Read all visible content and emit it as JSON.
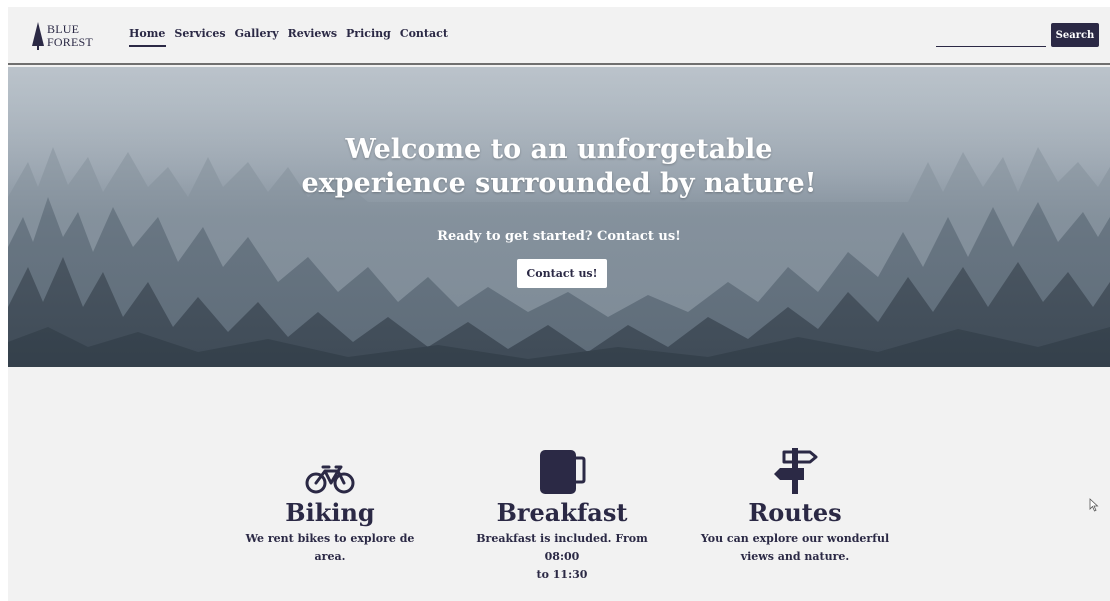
{
  "brand": {
    "line1": "BLUE",
    "line2": "FOREST",
    "logo_icon": "tree-icon"
  },
  "nav": {
    "items": [
      {
        "label": "Home",
        "active": true
      },
      {
        "label": "Services"
      },
      {
        "label": "Gallery"
      },
      {
        "label": "Reviews"
      },
      {
        "label": "Pricing"
      },
      {
        "label": "Contact"
      }
    ]
  },
  "search": {
    "placeholder": "",
    "value": "",
    "button_label": "Search"
  },
  "hero": {
    "title_line1": "Welcome to an unforgetable",
    "title_line2": "experience surrounded by nature!",
    "subtitle": "Ready to get started? Contact us!",
    "button_label": "Contact us!"
  },
  "features": [
    {
      "icon": "bicycle-icon",
      "title": "Biking",
      "text_line1": "We rent bikes to explore de area.",
      "text_line2": ""
    },
    {
      "icon": "mug-icon",
      "title": "Breakfast",
      "text_line1": "Breakfast is included. From 08:00",
      "text_line2": "to 11:30"
    },
    {
      "icon": "signpost-icon",
      "title": "Routes",
      "text_line1": "You can explore our wonderful",
      "text_line2": "views and nature."
    }
  ],
  "colors": {
    "primary": "#2b2945",
    "background": "#f2f2f2",
    "white": "#ffffff"
  }
}
